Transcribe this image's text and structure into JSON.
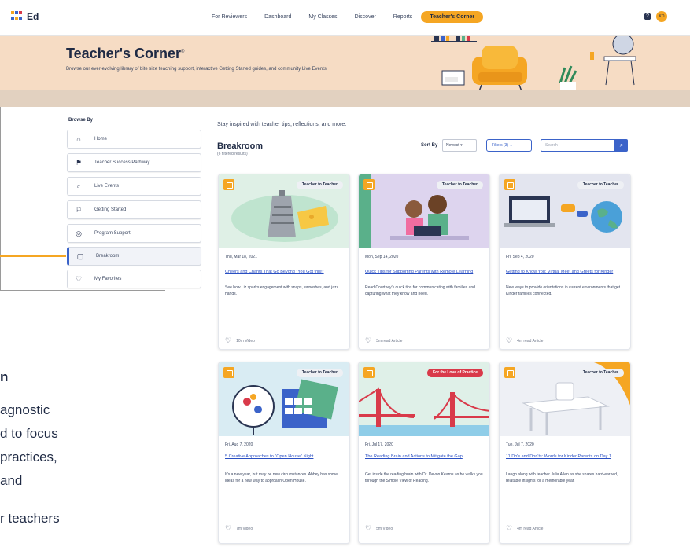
{
  "app": {
    "logo_text": "Ed"
  },
  "nav": {
    "items": [
      "For Reviewers",
      "Dashboard",
      "My Classes",
      "Discover",
      "Reports",
      "Teacher's Corner"
    ],
    "active_index": 5,
    "help": "?",
    "avatar": "KD"
  },
  "hero": {
    "title": "Teacher's Corner",
    "trademark": "®",
    "description": "Browse our ever-evolving library of bite size teaching support, interactive Getting Started guides, and community Live Events."
  },
  "sidebar": {
    "heading": "Browse By",
    "items": [
      {
        "label": "Home",
        "icon": "home-icon",
        "glyph": "⌂"
      },
      {
        "label": "Teacher Success Pathway",
        "icon": "flag-icon",
        "glyph": "⚑"
      },
      {
        "label": "Live Events",
        "icon": "microphone-icon",
        "glyph": "♂"
      },
      {
        "label": "Getting Started",
        "icon": "flag-outline-icon",
        "glyph": "⚐"
      },
      {
        "label": "Program Support",
        "icon": "globe-icon",
        "glyph": "◎"
      },
      {
        "label": "Breakroom",
        "icon": "mug-icon",
        "glyph": "▢"
      },
      {
        "label": "My Favorites",
        "icon": "heart-icon",
        "glyph": "♡"
      }
    ],
    "active_index": 5
  },
  "main": {
    "intro": "Stay inspired with teacher tips, reflections, and more.",
    "title": "Breakroom",
    "count": "(6 filtered results)",
    "sort_label": "Sort By",
    "sort_value": "Newest",
    "filters_label": "Filters (3)",
    "search_placeholder": "Search"
  },
  "cards": [
    {
      "tag": "Teacher to Teacher",
      "tag_type": "t2t",
      "date": "Thu, Mar 18, 2021",
      "title": "Cheers and Chants That Go Beyond \"You Got this!\"",
      "desc": "See how Liz sparks engagement with snaps, swooshes, and jazz hands.",
      "meta": "10m Video",
      "bg": "#dff0e6"
    },
    {
      "tag": "Teacher to Teacher",
      "tag_type": "t2t",
      "date": "Mon, Sep 14, 2020",
      "title": "Quick Tips for Supporting Parents with Remote Learning",
      "desc": "Read Courtney's quick tips for communicating with families and capturing what they know and need.",
      "meta": "3m read Article",
      "bg": "#ddd4ee"
    },
    {
      "tag": "Teacher to Teacher",
      "tag_type": "t2t",
      "date": "Fri, Sep 4, 2020",
      "title": "Getting to Know You: Virtual Meet and Greets for Kinder",
      "desc": "New ways to provide orientations in current environments that get Kinder families connected.",
      "meta": "4m read Article",
      "bg": "#e3e5ef"
    },
    {
      "tag": "Teacher to Teacher",
      "tag_type": "t2t",
      "date": "Fri, Aug 7, 2020",
      "title": "5 Creative Approaches to \"Open House\" Night",
      "desc": "It's a new year, but may be new circumstances. Abbey has some ideas for a new way to approach Open House.",
      "meta": "7m Video",
      "bg": "#d9ecf3"
    },
    {
      "tag": "For the Love of Practice",
      "tag_type": "love",
      "date": "Fri, Jul 17, 2020",
      "title": "The Reading Brain and Actions to Mitigate the Gap",
      "desc": "Get inside the reading brain with Dr. Devon Kearns as he walks you through the Simple View of Reading.",
      "meta": "5m Video",
      "bg": "#dff0e8"
    },
    {
      "tag": "Teacher to Teacher",
      "tag_type": "t2t",
      "date": "Tue, Jul 7, 2020",
      "title": "11 Do's and Don'ts: Words for Kinder Parents on Day 1",
      "desc": "Laugh along with teacher Julia Allen as she shares hard-earned, relatable insights for a memorable year.",
      "meta": "4m read Article",
      "bg": "#eef0f5"
    }
  ],
  "behind_text": {
    "lines": [
      "n",
      "agnostic",
      "d to focus",
      "practices,",
      "and",
      "r teachers"
    ]
  },
  "colors": {
    "accent": "#f5a623",
    "primary": "#3b63c9",
    "hero_bg": "#f6dcc4",
    "love_tag": "#d93a4a"
  }
}
